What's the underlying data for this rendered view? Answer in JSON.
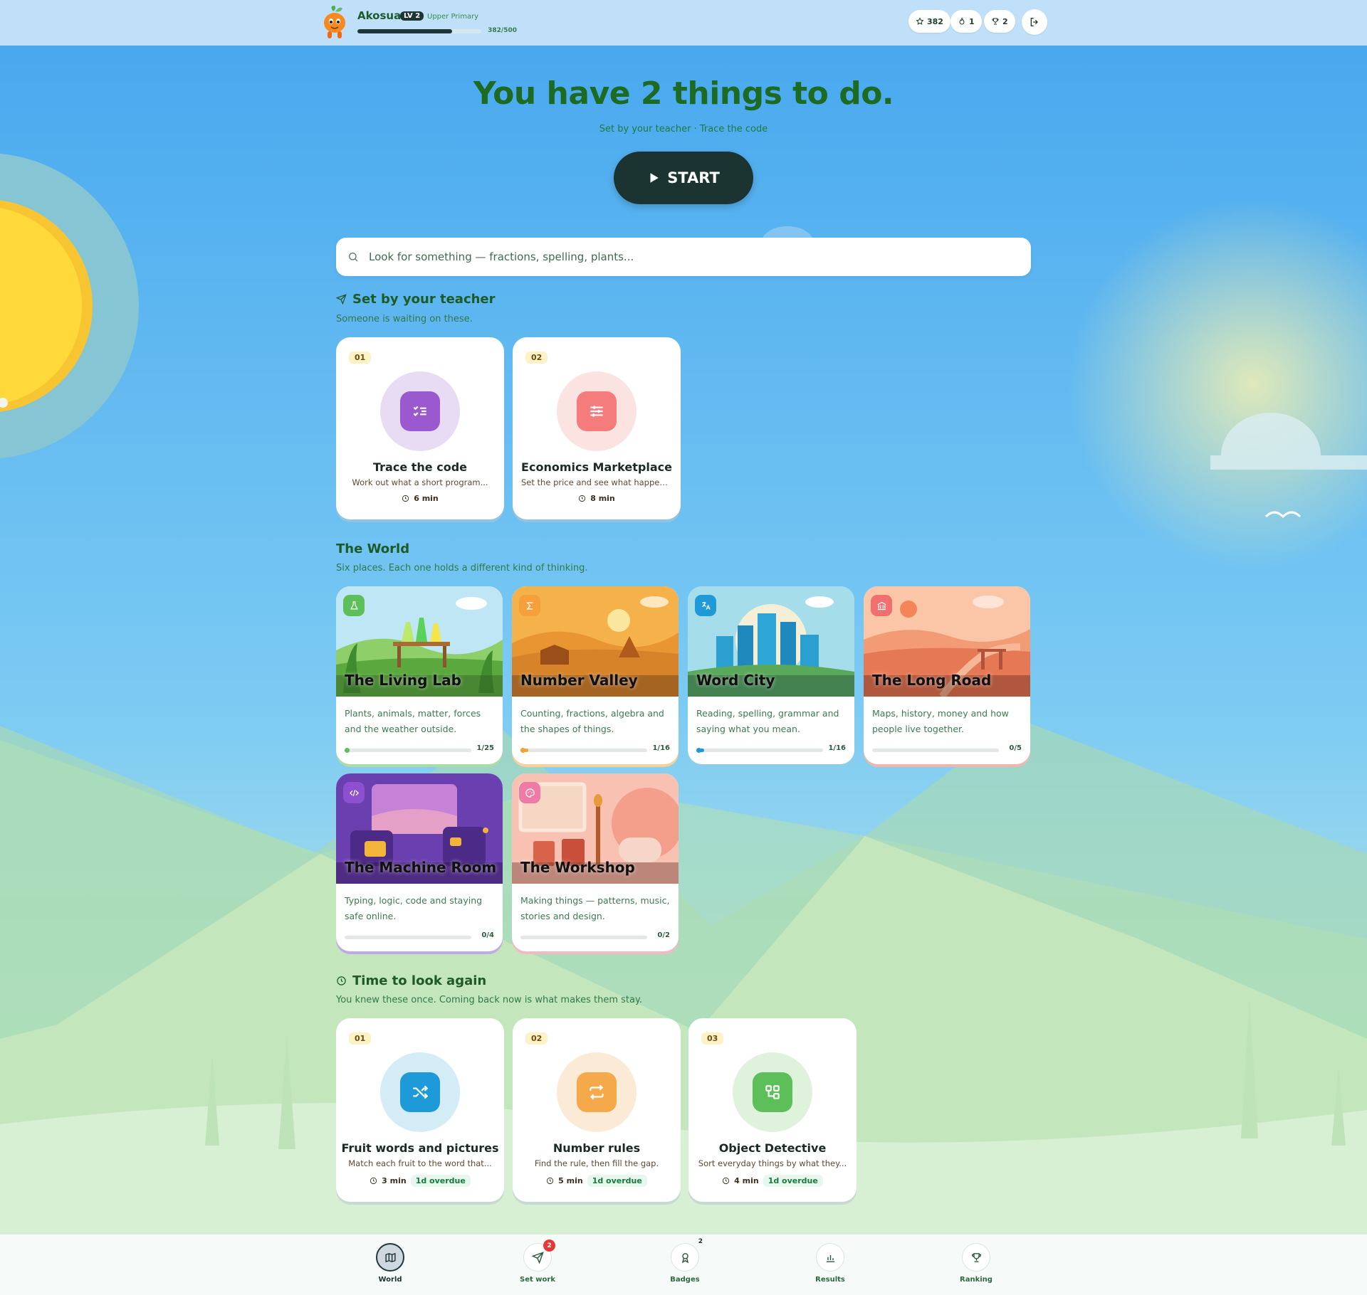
{
  "user": {
    "name": "Akosua",
    "level": "LV 2",
    "grade": "Upper Primary",
    "xp_text": "382/500",
    "xp_fraction": 0.764
  },
  "stats": [
    {
      "icon": "star-icon",
      "value": "382"
    },
    {
      "icon": "flame-icon",
      "value": "1"
    },
    {
      "icon": "trophy-icon",
      "value": "2"
    }
  ],
  "hero": {
    "title": "You have 2 things to do.",
    "subtitle": "Set by your teacher · Trace the code",
    "start_label": "START"
  },
  "search": {
    "placeholder": "Look for something — fractions, spelling, plants..."
  },
  "assigned": {
    "title": "Set by your teacher",
    "subtitle": "Someone is waiting on these.",
    "cards": [
      {
        "num": "01",
        "title": "Trace the code",
        "desc": "Work out what a short program...",
        "time": "6 min",
        "icon": "checklist-icon",
        "color": "#9b59d0",
        "halo": "#e7dcf3"
      },
      {
        "num": "02",
        "title": "Economics Marketplace",
        "desc": "Set the price and see what happens...",
        "time": "8 min",
        "icon": "sliders-icon",
        "color": "#f47c7c",
        "halo": "#fbe3e1"
      }
    ]
  },
  "world": {
    "title": "The World",
    "subtitle": "Six places. Each one holds a different kind of thinking.",
    "places": [
      {
        "title": "The Living Lab",
        "desc": "Plants, animals, matter, forces and the weather outside.",
        "progress": "1/25",
        "fraction": 0.04,
        "color": "#5cbf5a",
        "icon": "flask-icon"
      },
      {
        "title": "Number Valley",
        "desc": "Counting, fractions, algebra and the shapes of things.",
        "progress": "1/16",
        "fraction": 0.0625,
        "color": "#f5a03a",
        "icon": "sigma-icon"
      },
      {
        "title": "Word City",
        "desc": "Reading, spelling, grammar and saying what you mean.",
        "progress": "1/16",
        "fraction": 0.0625,
        "color": "#1f9ad8",
        "icon": "translate-icon"
      },
      {
        "title": "The Long Road",
        "desc": "Maps, history, money and how people live together.",
        "progress": "0/5",
        "fraction": 0,
        "color": "#f06f6f",
        "icon": "museum-icon"
      },
      {
        "title": "The Machine Room",
        "desc": "Typing, logic, code and staying safe online.",
        "progress": "0/4",
        "fraction": 0,
        "color": "#8e4fd0",
        "icon": "code-icon"
      },
      {
        "title": "The Workshop",
        "desc": "Making things — patterns, music, stories and design.",
        "progress": "0/2",
        "fraction": 0,
        "color": "#f07aa6",
        "icon": "palette-icon"
      }
    ]
  },
  "review": {
    "title": "Time to look again",
    "subtitle": "You knew these once. Coming back now is what makes them stay.",
    "cards": [
      {
        "num": "01",
        "title": "Fruit words and pictures",
        "desc": "Match each fruit to the word that...",
        "time": "3 min",
        "overdue": "1d overdue",
        "icon": "shuffle-icon",
        "color": "#1f9ad8",
        "halo": "#d3ecf6"
      },
      {
        "num": "02",
        "title": "Number rules",
        "desc": "Find the rule, then fill the gap.",
        "time": "5 min",
        "overdue": "1d overdue",
        "icon": "repeat-icon",
        "color": "#f5a94a",
        "halo": "#fbebd6"
      },
      {
        "num": "03",
        "title": "Object Detective",
        "desc": "Sort everyday things by what they...",
        "time": "4 min",
        "overdue": "1d overdue",
        "icon": "sort-icon",
        "color": "#5cbf5a",
        "halo": "#dff2dc"
      }
    ]
  },
  "nav": [
    {
      "label": "World",
      "icon": "map-icon",
      "active": true,
      "badge": ""
    },
    {
      "label": "Set work",
      "icon": "send-icon",
      "active": false,
      "badge": "2"
    },
    {
      "label": "Badges",
      "icon": "medal-icon",
      "active": false,
      "badge": "2"
    },
    {
      "label": "Results",
      "icon": "bar-chart-icon",
      "active": false,
      "badge": ""
    },
    {
      "label": "Ranking",
      "icon": "trophy-icon",
      "active": false,
      "badge": ""
    }
  ]
}
